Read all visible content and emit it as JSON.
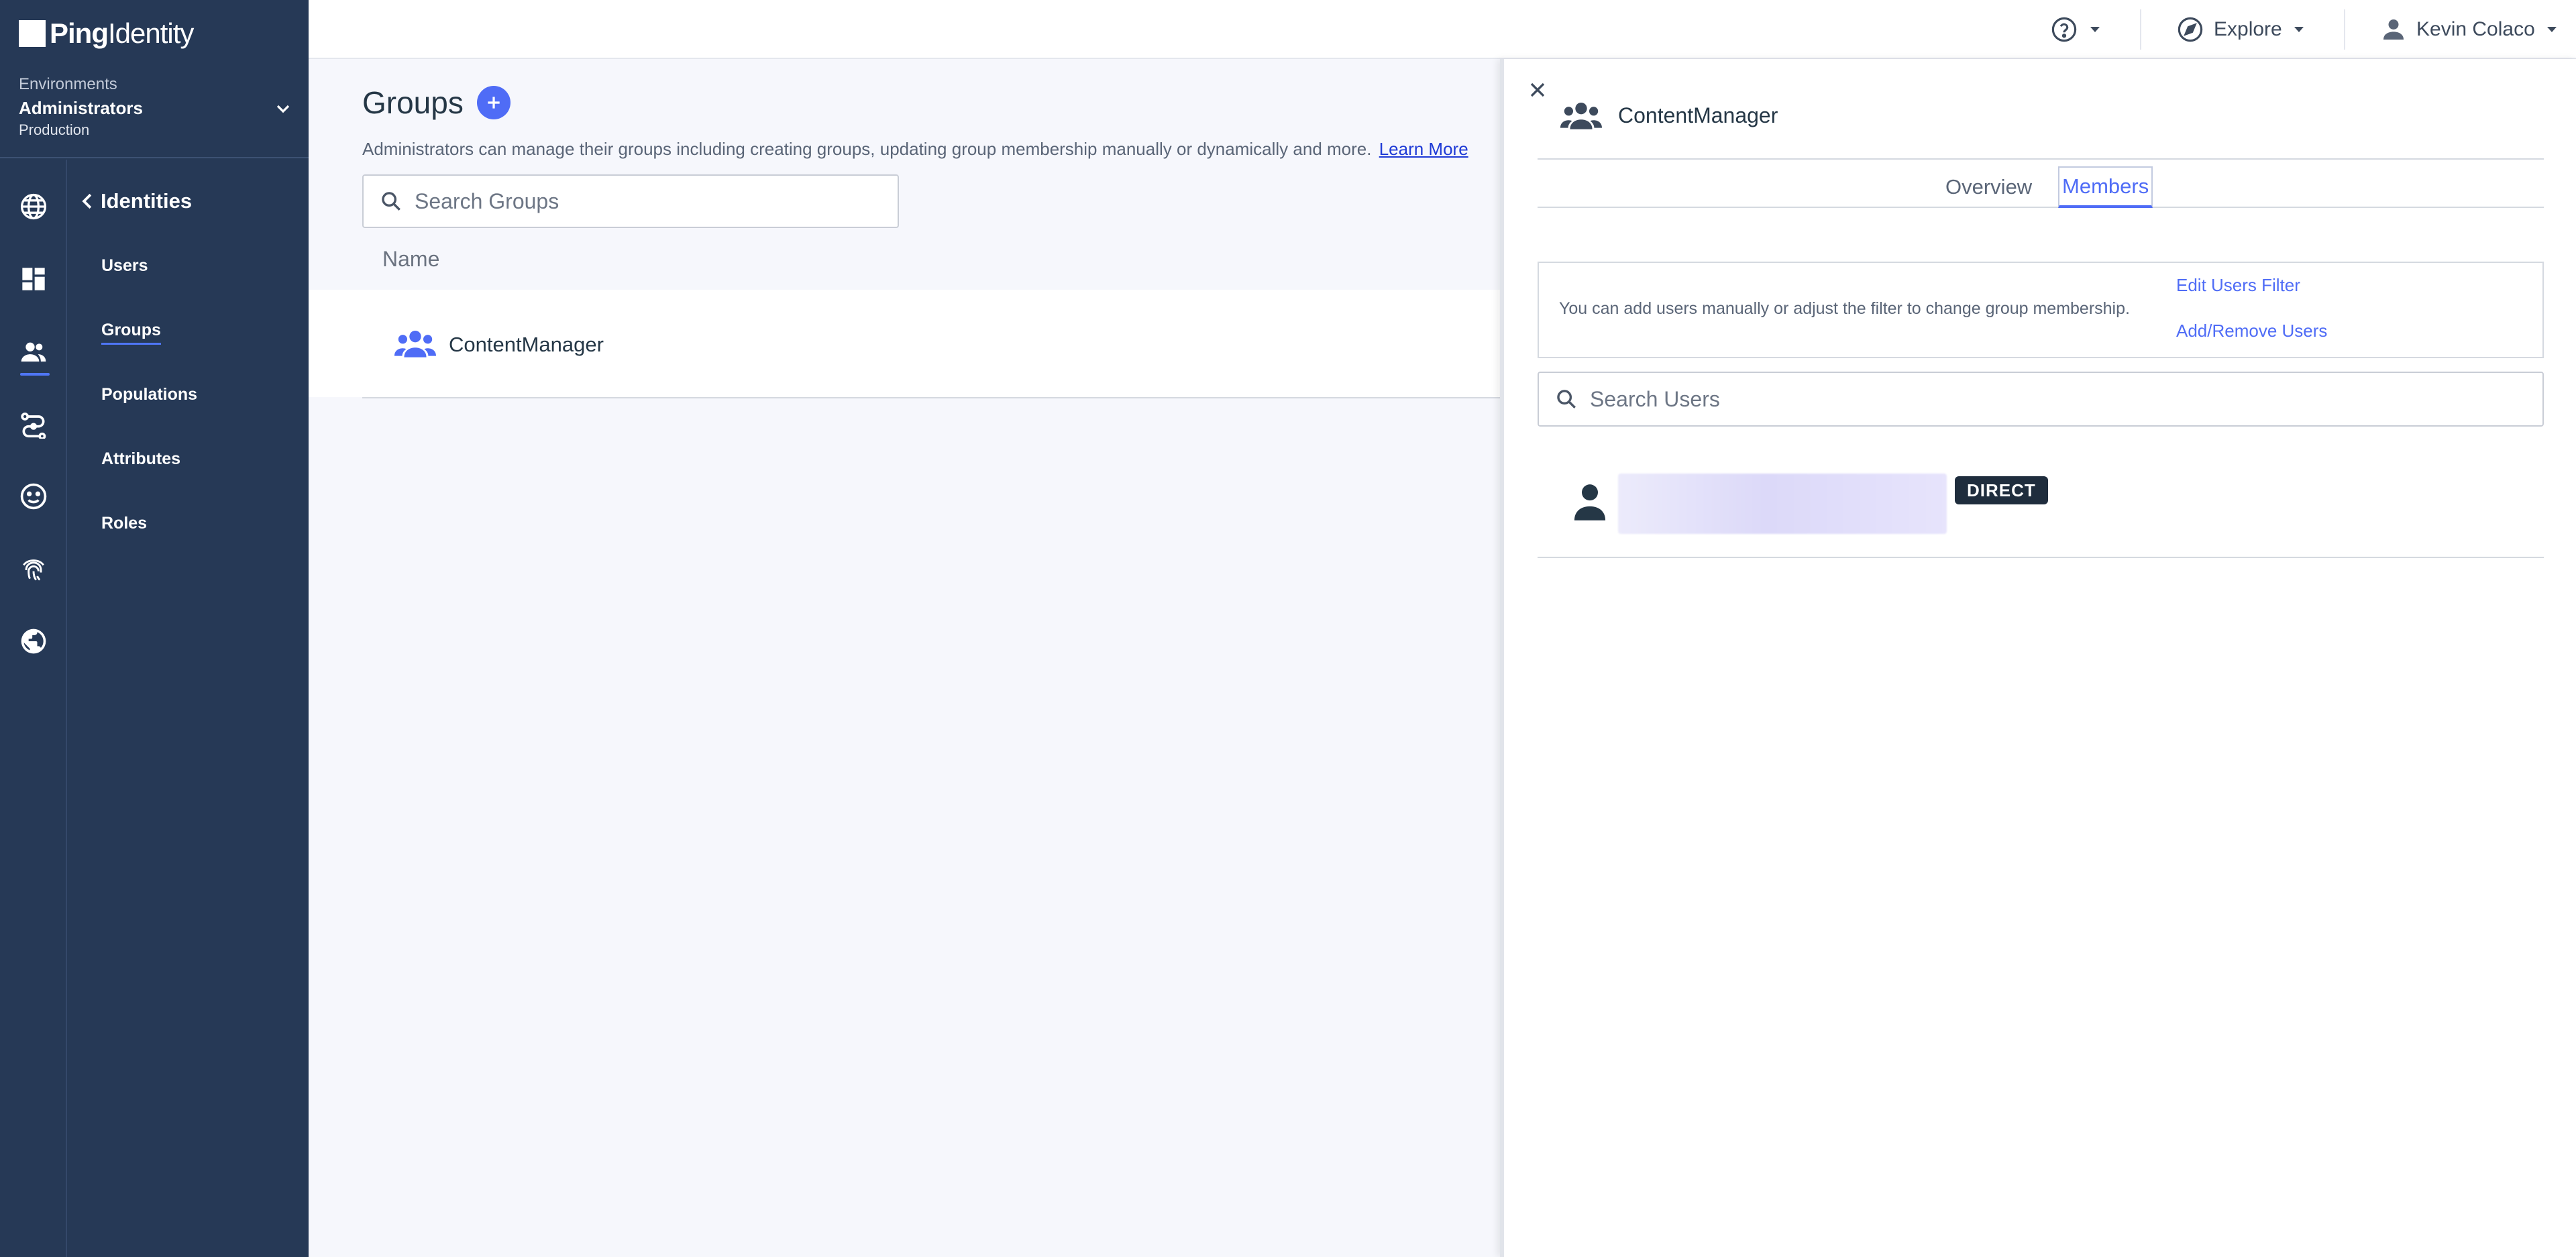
{
  "brand": {
    "bold": "Ping",
    "light": "Identity"
  },
  "environment": {
    "caption": "Environments",
    "name": "Administrators",
    "type": "Production"
  },
  "nav": {
    "section_title": "Identities",
    "items": [
      {
        "label": "Users",
        "active": false
      },
      {
        "label": "Groups",
        "active": true
      },
      {
        "label": "Populations",
        "active": false
      },
      {
        "label": "Attributes",
        "active": false
      },
      {
        "label": "Roles",
        "active": false
      }
    ]
  },
  "rail_icons": [
    "globe-icon",
    "dashboard-icon",
    "identities-icon",
    "connections-icon",
    "experiences-icon",
    "fingerprint-icon",
    "world-icon"
  ],
  "header": {
    "explore_label": "Explore",
    "user_name": "Kevin Colaco"
  },
  "groups_page": {
    "title": "Groups",
    "description": "Administrators can manage their groups including creating groups, updating group membership manually or dynamically and more.",
    "learn_more": "Learn More",
    "search_placeholder": "Search Groups",
    "column_name": "Name",
    "rows": [
      {
        "name": "ContentManager"
      }
    ]
  },
  "panel": {
    "title": "ContentManager",
    "tabs": [
      {
        "label": "Overview",
        "active": false
      },
      {
        "label": "Members",
        "active": true
      }
    ],
    "info_message": "You can add users manually or adjust the filter to change group membership.",
    "edit_filter_label": "Edit Users Filter",
    "add_remove_label": "Add/Remove Users",
    "search_placeholder": "Search Users",
    "members": [
      {
        "badge": "DIRECT"
      }
    ]
  },
  "colors": {
    "sidebar": "#263956",
    "accent": "#4f6cf6",
    "badge_bg": "#1f2d3d"
  }
}
